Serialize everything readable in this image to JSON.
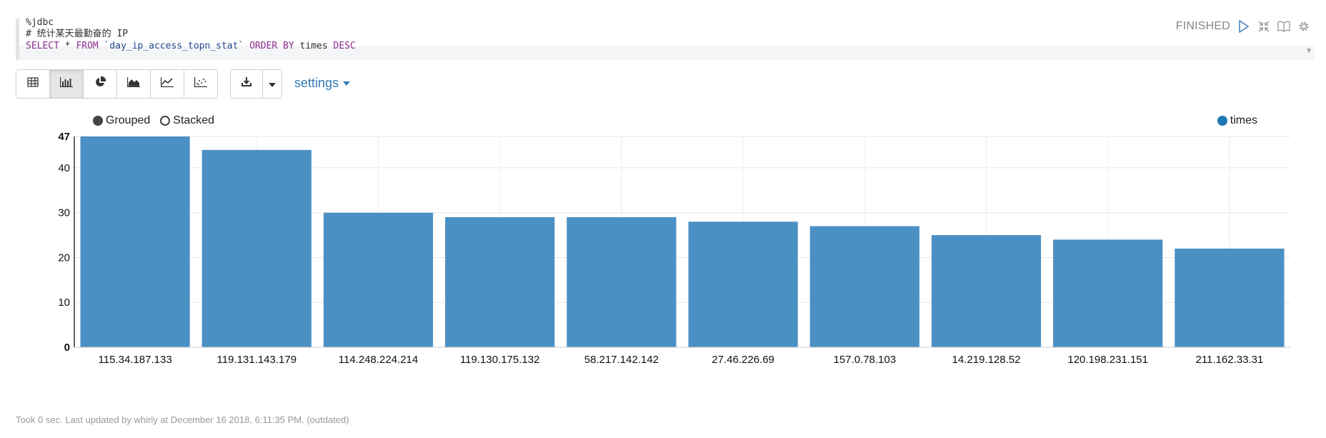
{
  "editor": {
    "line1": "%jdbc",
    "line2": "# 统计某天最勤奋的 IP",
    "line3": {
      "kw1": "SELECT",
      "star": " * ",
      "kw2": "FROM",
      "table": " `day_ip_access_topn_stat` ",
      "kw3": "ORDER BY",
      "col": " times ",
      "kw4": "DESC"
    }
  },
  "paragraph": {
    "status": "FINISHED",
    "icons": [
      "run-icon",
      "collapse-icon",
      "book-icon",
      "gear-icon"
    ]
  },
  "toolbar": {
    "chart_buttons": [
      "table-icon",
      "bar-chart-icon",
      "pie-chart-icon",
      "area-chart-icon",
      "line-chart-icon",
      "scatter-chart-icon"
    ],
    "active": "bar-chart-icon",
    "download_icon": "download-icon",
    "dropdown_icon": "caret-down-icon",
    "settings_label": "settings"
  },
  "legend": {
    "grouped_label": "Grouped",
    "stacked_label": "Stacked",
    "series_name": "times",
    "series_color": "#1f77b4"
  },
  "chart_data": {
    "type": "bar",
    "categories": [
      "115.34.187.133",
      "119.131.143.179",
      "114.248.224.214",
      "119.130.175.132",
      "58.217.142.142",
      "27.46.226.69",
      "157.0.78.103",
      "14.219.128.52",
      "120.198.231.151",
      "211.162.33.31"
    ],
    "series": [
      {
        "name": "times",
        "values": [
          47,
          44,
          30,
          29,
          29,
          28,
          27,
          25,
          24,
          22
        ]
      }
    ],
    "ylim": [
      0,
      47
    ],
    "yticks": [
      0,
      10,
      20,
      30,
      40,
      47
    ],
    "grid": true,
    "legend": "top-right",
    "bar_color": "#4a90c4"
  },
  "footer": {
    "text": "Took 0 sec. Last updated by whirly at December 16 2018, 6:11:35 PM. (outdated)"
  }
}
